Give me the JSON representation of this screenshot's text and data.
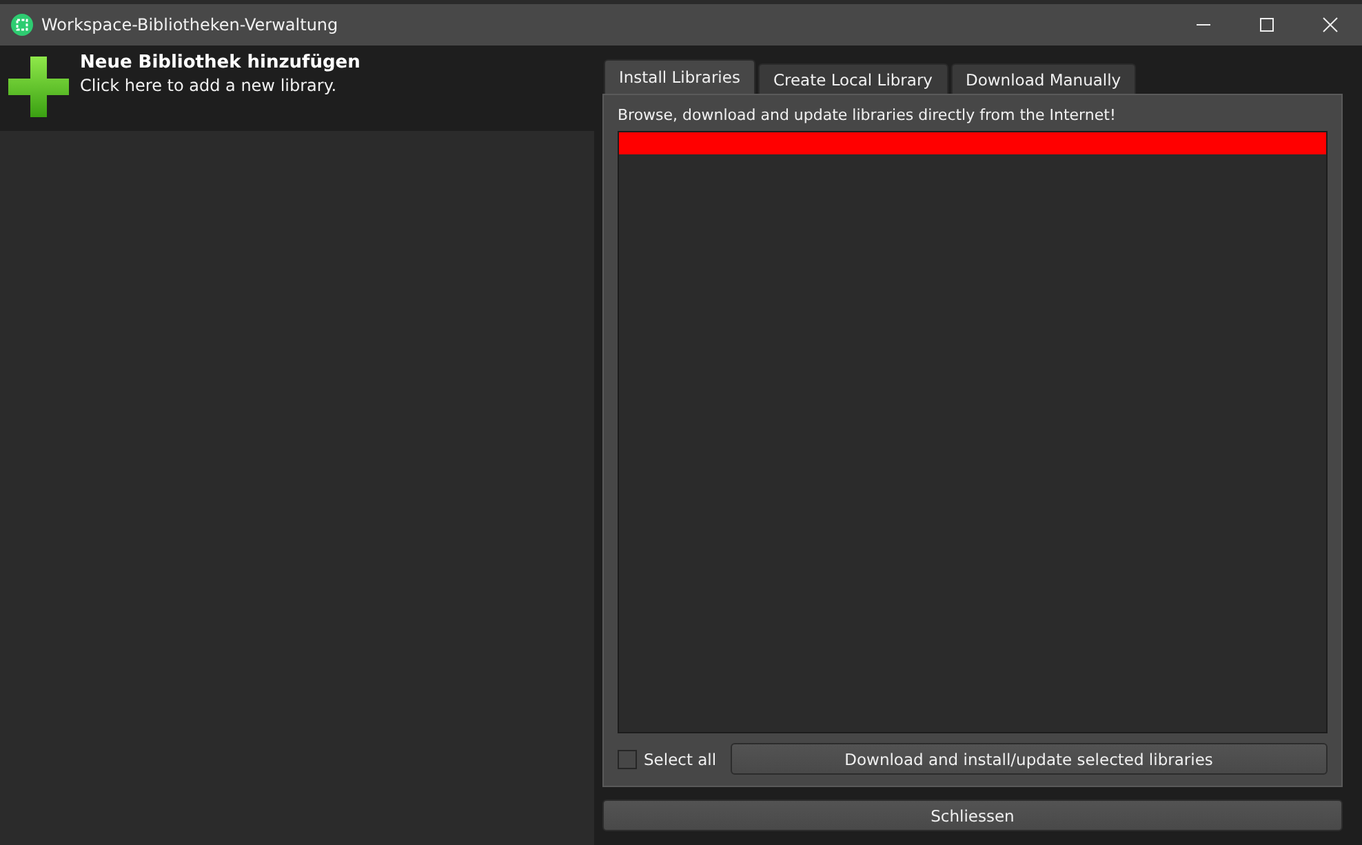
{
  "window": {
    "title": "Workspace-Bibliotheken-Verwaltung"
  },
  "add_library": {
    "title": "Neue Bibliothek hinzufügen",
    "subtitle": "Click here to add a new library."
  },
  "tabs": [
    {
      "label": "Install Libraries",
      "selected": true
    },
    {
      "label": "Create Local Library",
      "selected": false
    },
    {
      "label": "Download Manually",
      "selected": false
    }
  ],
  "install": {
    "description": "Browse, download and update libraries directly from the Internet!",
    "select_all": {
      "label": "Select all",
      "checked": false
    },
    "install_button": "Download and install/update selected libraries"
  },
  "close_button": "Schliessen"
}
